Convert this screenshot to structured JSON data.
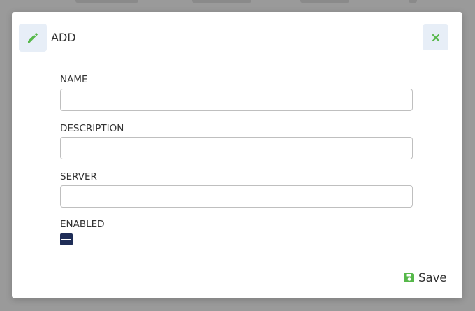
{
  "dialog": {
    "title": "ADD",
    "close_icon": "close-icon",
    "header_icon": "pencil-icon"
  },
  "form": {
    "fields": [
      {
        "label": "NAME",
        "value": "",
        "placeholder": ""
      },
      {
        "label": "DESCRIPTION",
        "value": "",
        "placeholder": ""
      },
      {
        "label": "SERVER",
        "value": "",
        "placeholder": ""
      }
    ],
    "enabled": {
      "label": "ENABLED",
      "state": "indeterminate"
    }
  },
  "footer": {
    "save_label": "Save",
    "save_icon": "floppy-disk-icon"
  },
  "colors": {
    "accent_green": "#56b84a",
    "icon_box_bg": "#e7eef7",
    "checkbox_navy": "#1f2d57",
    "overlay": "#9a9a9a"
  }
}
